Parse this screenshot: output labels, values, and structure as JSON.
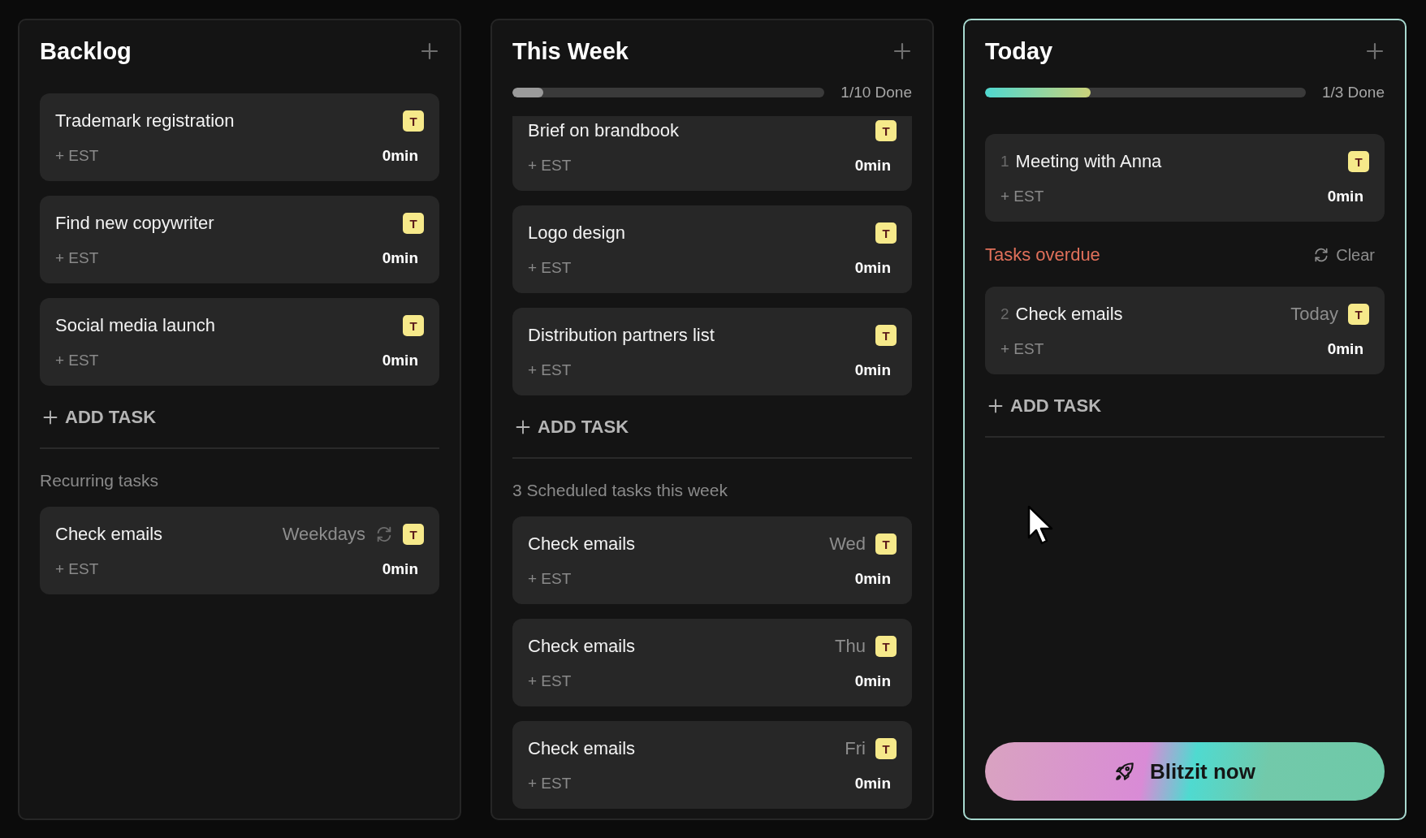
{
  "columns": [
    {
      "title": "Backlog",
      "highlighted": false,
      "tasks": [
        {
          "title": "Trademark registration",
          "recurring": false,
          "cut_off": false,
          "tag": "T",
          "estimate": "+ EST",
          "time": "0min"
        },
        {
          "title": "Find new copywriter",
          "recurring": false,
          "cut_off": false,
          "tag": "T",
          "estimate": "+ EST",
          "time": "0min"
        },
        {
          "title": "Social media launch",
          "recurring": false,
          "cut_off": false,
          "tag": "T",
          "estimate": "+ EST",
          "time": "0min"
        }
      ],
      "add_task": "ADD TASK",
      "section": {
        "label": "Recurring tasks",
        "tasks": [
          {
            "title": "Check emails",
            "when": "Weekdays",
            "recurring": true,
            "cut_off": false,
            "tag": "T",
            "estimate": "+ EST",
            "time": "0min"
          }
        ]
      }
    },
    {
      "title": "This Week",
      "highlighted": false,
      "progress": {
        "level": 0.1,
        "label": "1/10 Done",
        "kind": "plain"
      },
      "tasks": [
        {
          "title": "Brief on brandbook",
          "recurring": false,
          "cut_off": true,
          "tag": "T",
          "estimate": "+ EST",
          "time": "0min"
        },
        {
          "title": "Logo design",
          "recurring": false,
          "cut_off": false,
          "tag": "T",
          "estimate": "+ EST",
          "time": "0min"
        },
        {
          "title": "Distribution partners list",
          "recurring": false,
          "cut_off": false,
          "tag": "T",
          "estimate": "+ EST",
          "time": "0min"
        }
      ],
      "add_task": "ADD TASK",
      "section": {
        "label": "3 Scheduled tasks this week",
        "tasks": [
          {
            "title": "Check emails",
            "when": "Wed",
            "recurring": false,
            "cut_off": false,
            "tag": "T",
            "estimate": "+ EST",
            "time": "0min"
          },
          {
            "title": "Check emails",
            "when": "Thu",
            "recurring": false,
            "cut_off": false,
            "tag": "T",
            "estimate": "+ EST",
            "time": "0min"
          },
          {
            "title": "Check emails",
            "when": "Fri",
            "recurring": false,
            "cut_off": false,
            "tag": "T",
            "estimate": "+ EST",
            "time": "0min"
          }
        ]
      }
    },
    {
      "title": "Today",
      "highlighted": true,
      "progress": {
        "level": 0.33,
        "label": "1/3 Done",
        "kind": "gradient"
      },
      "tasks": [
        {
          "number": "1",
          "title": "Meeting with Anna",
          "recurring": false,
          "cut_off": false,
          "tag": "T",
          "estimate": "+ EST",
          "time": "0min"
        }
      ],
      "overdue": {
        "label": "Tasks overdue",
        "action": "Clear",
        "tasks": [
          {
            "number": "2",
            "title": "Check emails",
            "when": "Today",
            "recurring": false,
            "cut_off": false,
            "tag": "T",
            "estimate": "+ EST",
            "time": "0min"
          }
        ]
      },
      "add_task": "ADD TASK",
      "action_button": "Blitzit now"
    }
  ]
}
